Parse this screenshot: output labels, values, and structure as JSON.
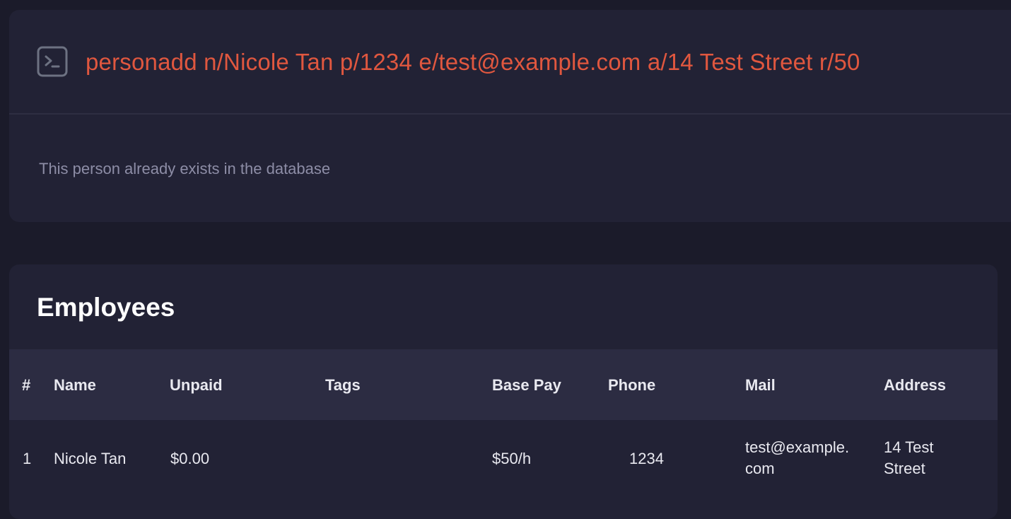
{
  "command": {
    "value": "personadd n/Nicole Tan p/1234 e/test@example.com a/14 Test Street r/50",
    "result": "This person already exists in the database"
  },
  "employees": {
    "title": "Employees",
    "columns": [
      "#",
      "Name",
      "Unpaid",
      "Tags",
      "Base Pay",
      "Phone",
      "Mail",
      "Address"
    ],
    "rows": [
      {
        "index": "1",
        "name": "Nicole Tan",
        "unpaid": "$0.00",
        "tags": "",
        "base_pay": "$50/h",
        "phone": "1234",
        "mail_line1": "test@example.",
        "mail_line2": "com",
        "address_line1": "14 Test",
        "address_line2": "Street"
      }
    ]
  },
  "icons": {
    "terminal": "terminal-prompt-icon"
  },
  "colors": {
    "background": "#1b1b2a",
    "panel": "#222235",
    "header": "#2c2c42",
    "command_text": "#e0573f",
    "result_text": "#8d8da6"
  }
}
